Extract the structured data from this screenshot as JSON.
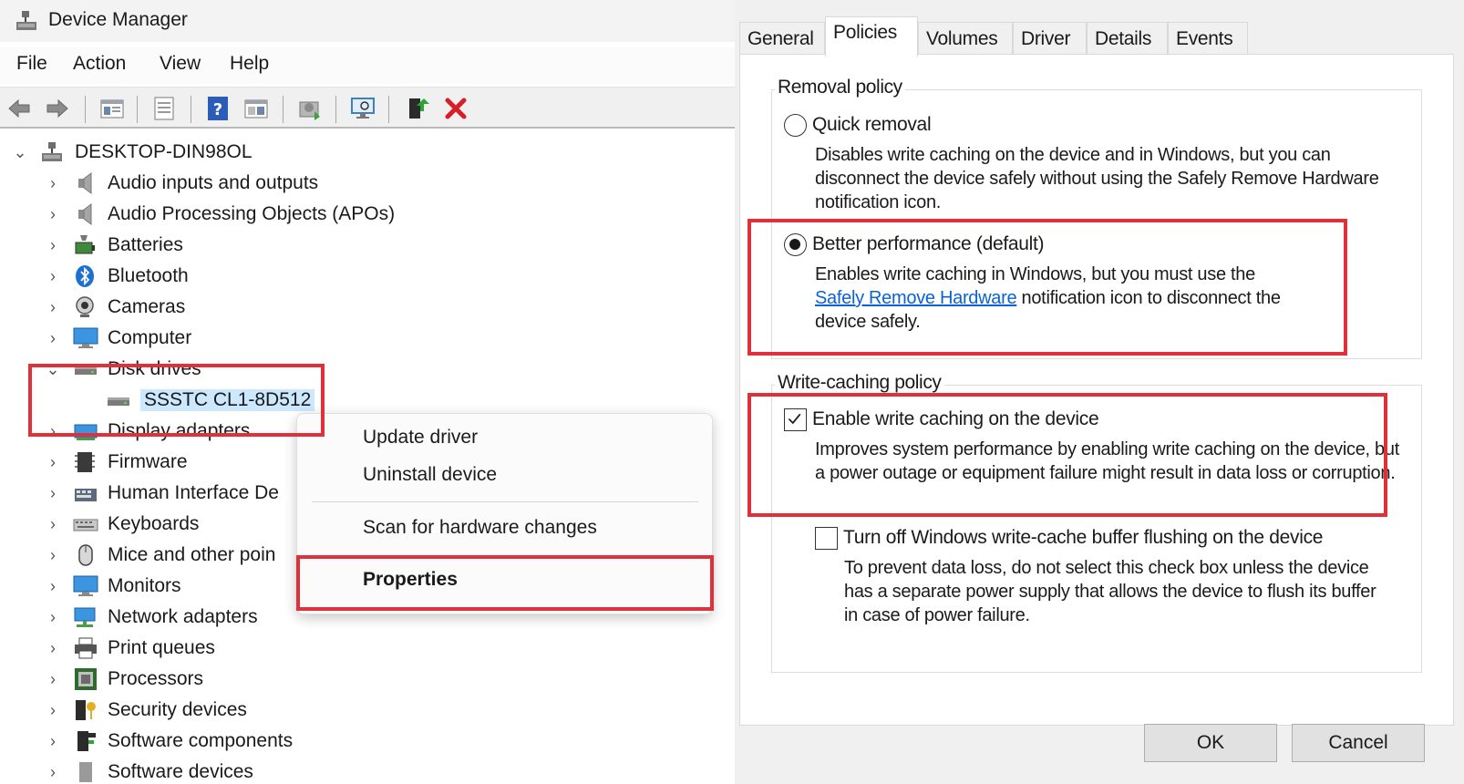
{
  "device_manager": {
    "title": "Device Manager",
    "menu": [
      "File",
      "Action",
      "View",
      "Help"
    ],
    "toolbar": [
      "back-icon",
      "forward-icon",
      "properties-pane-icon",
      "show-hidden-icon",
      "help-icon",
      "view-icon",
      "update-driver-icon",
      "scan-hardware-icon",
      "enable-device-icon",
      "uninstall-icon"
    ],
    "tree": {
      "root": "DESKTOP-DIN98OL",
      "categories": [
        "Audio inputs and outputs",
        "Audio Processing Objects (APOs)",
        "Batteries",
        "Bluetooth",
        "Cameras",
        "Computer",
        "Disk drives",
        "Display adapters",
        "Firmware",
        "Human Interface De",
        "Keyboards",
        "Mice and other poin",
        "Monitors",
        "Network adapters",
        "Print queues",
        "Processors",
        "Security devices",
        "Software components",
        "Software devices"
      ],
      "disk_child": "SSSTC CL1-8D512"
    },
    "context_menu": {
      "items": [
        "Update driver",
        "Uninstall device",
        "Scan for hardware changes",
        "Properties"
      ]
    }
  },
  "properties": {
    "tabs": [
      "General",
      "Policies",
      "Volumes",
      "Driver",
      "Details",
      "Events"
    ],
    "active_tab": "Policies",
    "removal_policy": {
      "label": "Removal policy",
      "quick_label": "Quick removal",
      "quick_desc": "Disables write caching on the device and in Windows, but you can disconnect the device safely without using the Safely Remove Hardware notification icon.",
      "better_label": "Better performance (default)",
      "better_desc_1": "Enables write caching in Windows, but you must use the",
      "better_link": "Safely Remove Hardware",
      "better_desc_2": " notification icon to disconnect the",
      "better_desc_3": "device safely.",
      "selected": "Better performance (default)"
    },
    "write_caching": {
      "label": "Write-caching policy",
      "enable_label": "Enable write caching on the device",
      "enable_checked": true,
      "enable_desc": "Improves system performance by enabling write caching on the device, but a power outage or equipment failure might result in data loss or corruption.",
      "flush_label": "Turn off Windows write-cache buffer flushing on the device",
      "flush_checked": false,
      "flush_desc": "To prevent data loss, do not select this check box unless the device has a separate power supply that allows the device to flush its buffer in case of power failure."
    },
    "buttons": {
      "ok": "OK",
      "cancel": "Cancel"
    }
  },
  "colors": {
    "highlight": "#e0313a",
    "link": "#0b62d6"
  }
}
